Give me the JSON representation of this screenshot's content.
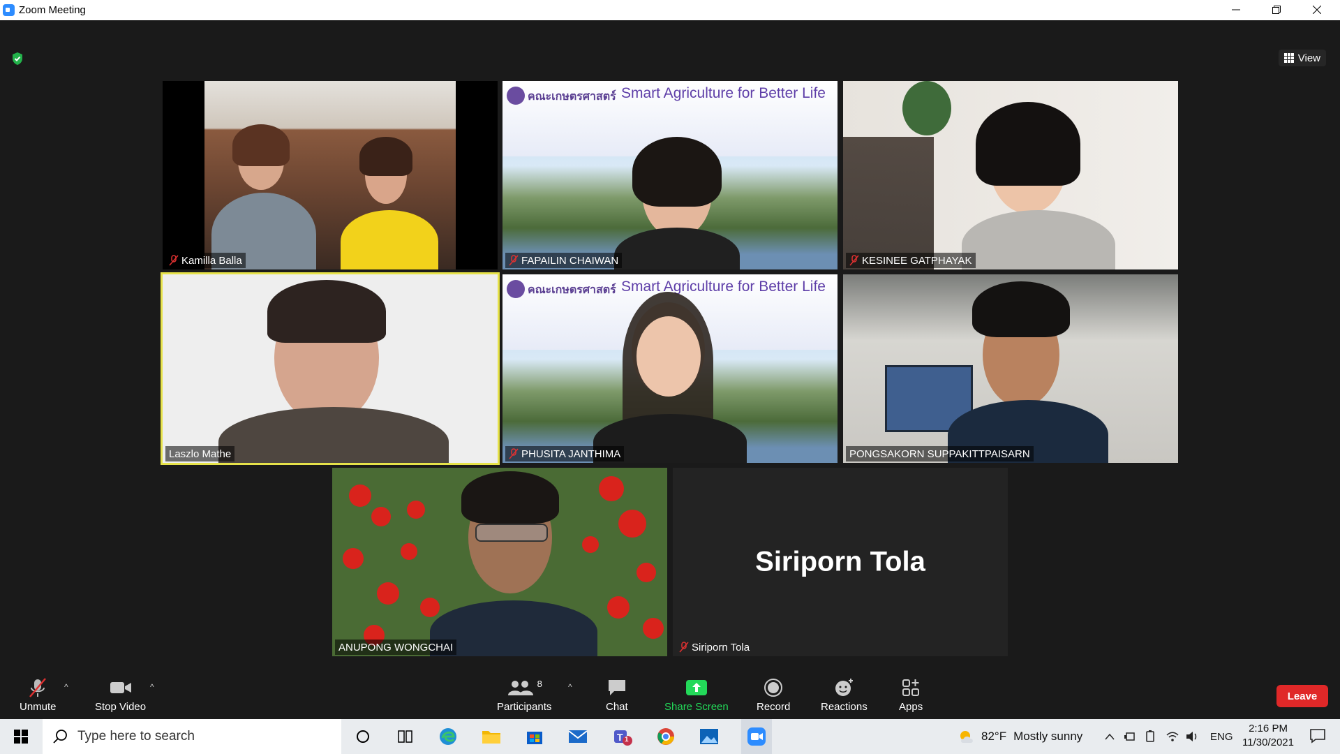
{
  "window": {
    "title": "Zoom Meeting"
  },
  "top": {
    "view_label": "View"
  },
  "participants": [
    {
      "name": "Kamilla Balla",
      "muted": true
    },
    {
      "name": "FAPAILIN CHAIWAN",
      "muted": true
    },
    {
      "name": "KESINEE GATPHAYAK",
      "muted": true
    },
    {
      "name": "Laszlo Mathe",
      "muted": false
    },
    {
      "name": "PHUSITA JANTHIMA",
      "muted": true
    },
    {
      "name": "PONGSAKORN SUPPAKITTPAISARN",
      "muted": false
    },
    {
      "name": "ANUPONG WONGCHAI",
      "muted": false
    },
    {
      "name": "Siriporn Tola",
      "muted": true
    }
  ],
  "banner": {
    "logo_text": "คณะเกษตรศาสตร์",
    "title": "Smart Agriculture for Better Life"
  },
  "no_video_name": "Siriporn Tola",
  "controls": {
    "unmute": "Unmute",
    "stop_video": "Stop Video",
    "participants": "Participants",
    "participants_count": "8",
    "chat": "Chat",
    "share_screen": "Share Screen",
    "record": "Record",
    "reactions": "Reactions",
    "apps": "Apps",
    "leave": "Leave"
  },
  "taskbar": {
    "search_placeholder": "Type here to search",
    "weather_temp": "82°F",
    "weather_text": "Mostly sunny",
    "language": "ENG",
    "time": "2:16 PM",
    "date": "11/30/2021",
    "teams_badge": "1"
  },
  "colors": {
    "accent": "#2d8cff",
    "leave": "#e02828",
    "share": "#23d959",
    "speaker": "#e6e24a"
  }
}
